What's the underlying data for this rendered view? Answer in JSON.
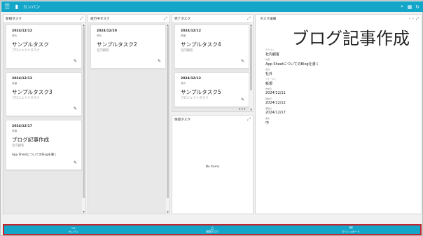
{
  "app": {
    "title": "カンバン",
    "menu_icon": "menu-icon",
    "app_icon": "clipboard-icon",
    "actions": [
      "search-icon",
      "grid-icon",
      "refresh-icon"
    ],
    "brand_color": "#14a6c9",
    "highlight_color": "#c1272d"
  },
  "columns": [
    {
      "title": "新規タスク",
      "cards": [
        {
          "date": "2024/12/12",
          "status": "低め",
          "name": "サンプルタスク",
          "sub": "プロジェクトタスク"
        },
        {
          "date": "2024/12/13",
          "status": "低番",
          "name": "サンプルタスク3",
          "sub": "プロジェクトタスク"
        },
        {
          "date": "2024/12/17",
          "status": "低番",
          "name": "ブログ記事作成",
          "sub": "社内顧客",
          "desc": "App SheetについてのBlogを書く"
        }
      ]
    },
    {
      "title": "進行中タスク",
      "cards": [
        {
          "date": "2024/12/20",
          "status": "低め",
          "name": "サンプルタスク2",
          "sub": "社内顧客"
        }
      ]
    },
    {
      "title": "完了タスク",
      "cards": [
        {
          "date": "2024/12/12",
          "status": "低番",
          "name": "サンプルタスク4",
          "sub": "社内顧客"
        },
        {
          "date": "2024/12/12",
          "status": "低め",
          "name": "サンプルタスク5",
          "sub": "プロジェクトタスク"
        }
      ]
    },
    {
      "title": "保留タスク",
      "empty": "No items"
    }
  ],
  "detail": {
    "header": "タスク詳細",
    "title": "ブログ記事作成",
    "fields": [
      {
        "label": "カテゴリ",
        "value": "社内顧客"
      },
      {
        "label": "内容",
        "value": "App SheetについてのBlogを書く"
      },
      {
        "label": "担当",
        "value": "社外"
      },
      {
        "label": "ステータス",
        "value": "新規"
      },
      {
        "label": "作成日",
        "value": "2024/12/11"
      },
      {
        "label": "開始日",
        "value": "2024/12/12"
      },
      {
        "label": "期限日",
        "value": "2024/12/17"
      },
      {
        "label": "優先",
        "value": "中"
      }
    ]
  },
  "bottom_nav": [
    {
      "icon": "kanban-icon",
      "label": "カンバン"
    },
    {
      "icon": "warning-icon",
      "label": "期限タスク"
    },
    {
      "icon": "dashboard-icon",
      "label": "ダッシュボード"
    }
  ]
}
